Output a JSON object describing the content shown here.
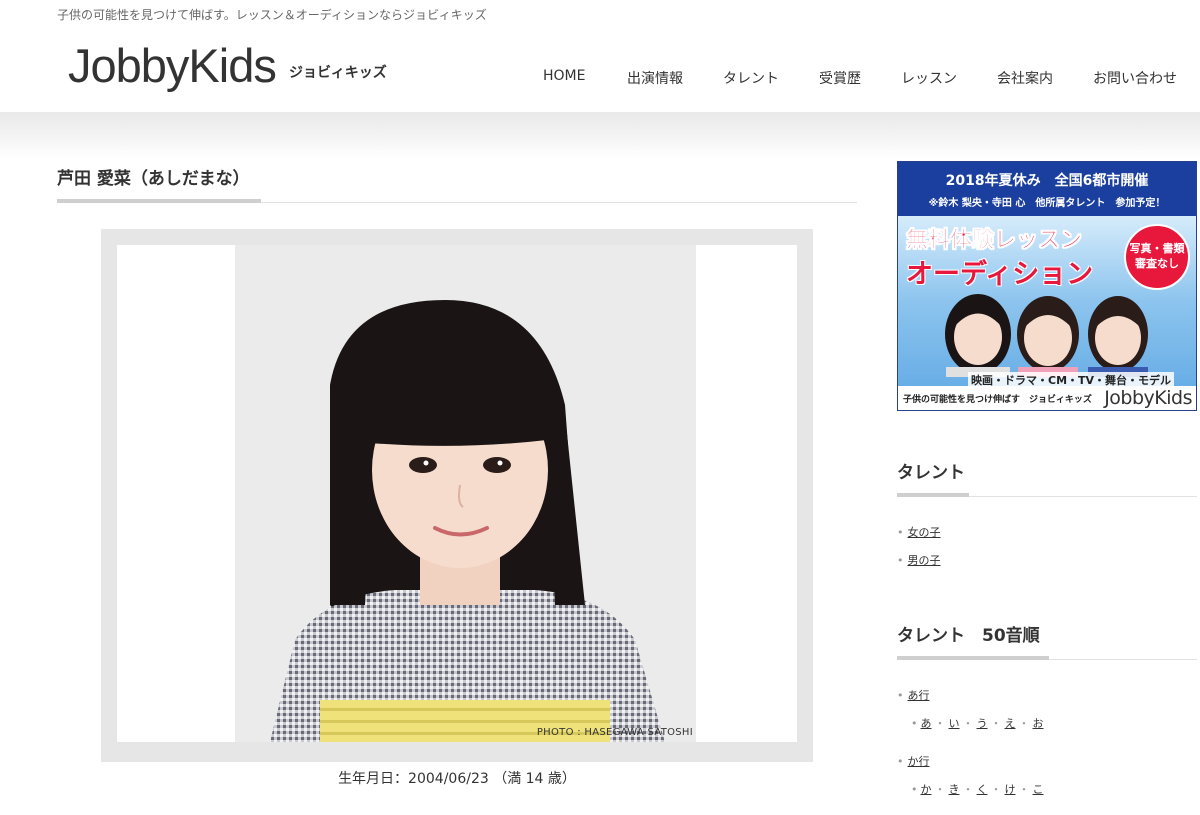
{
  "header": {
    "tagline": "子供の可能性を見つけて伸ばす。レッスン＆オーディションならジョビィキッズ",
    "logo": "JobbyKids",
    "logo_sub": "ジョビィキッズ"
  },
  "nav": [
    "HOME",
    "出演情報",
    "タレント",
    "受賞歴",
    "レッスン",
    "会社案内",
    "お問い合わせ"
  ],
  "main": {
    "title": "芦田 愛菜（あしだまな）",
    "photo_credit": "PHOTO : HASEGAWA SATOSHI",
    "birth": "生年月日：2004/06/23 （満 14 歳）"
  },
  "banner": {
    "top_line": "2018年夏休み　全国6都市開催",
    "sub_line": "※鈴木 梨央・寺田 心　他所属タレント　参加予定！",
    "headline1": "無料体験レッスン",
    "headline2": "オーディション",
    "circle": "写真・書類\n審査なし",
    "genres": "映画・ドラマ・CM・TV・舞台・モデル",
    "foot_left": "子供の可能性を見つけ伸ばす　ジョビィキッズ",
    "foot_logo": "JobbyKids"
  },
  "sidebar": {
    "talent_heading": "タレント",
    "talent_items": [
      "女の子",
      "男の子"
    ],
    "kana_heading": "タレント　50音順",
    "groups": [
      {
        "label": "あ行",
        "chars": [
          "あ",
          "い",
          "う",
          "え",
          "お"
        ]
      },
      {
        "label": "か行",
        "chars": [
          "か",
          "き",
          "く",
          "け",
          "こ"
        ]
      }
    ]
  },
  "colors": {
    "banner_blue": "#1b3f9e",
    "banner_red": "#e8183c",
    "accent_gray": "#cfcfcf"
  }
}
